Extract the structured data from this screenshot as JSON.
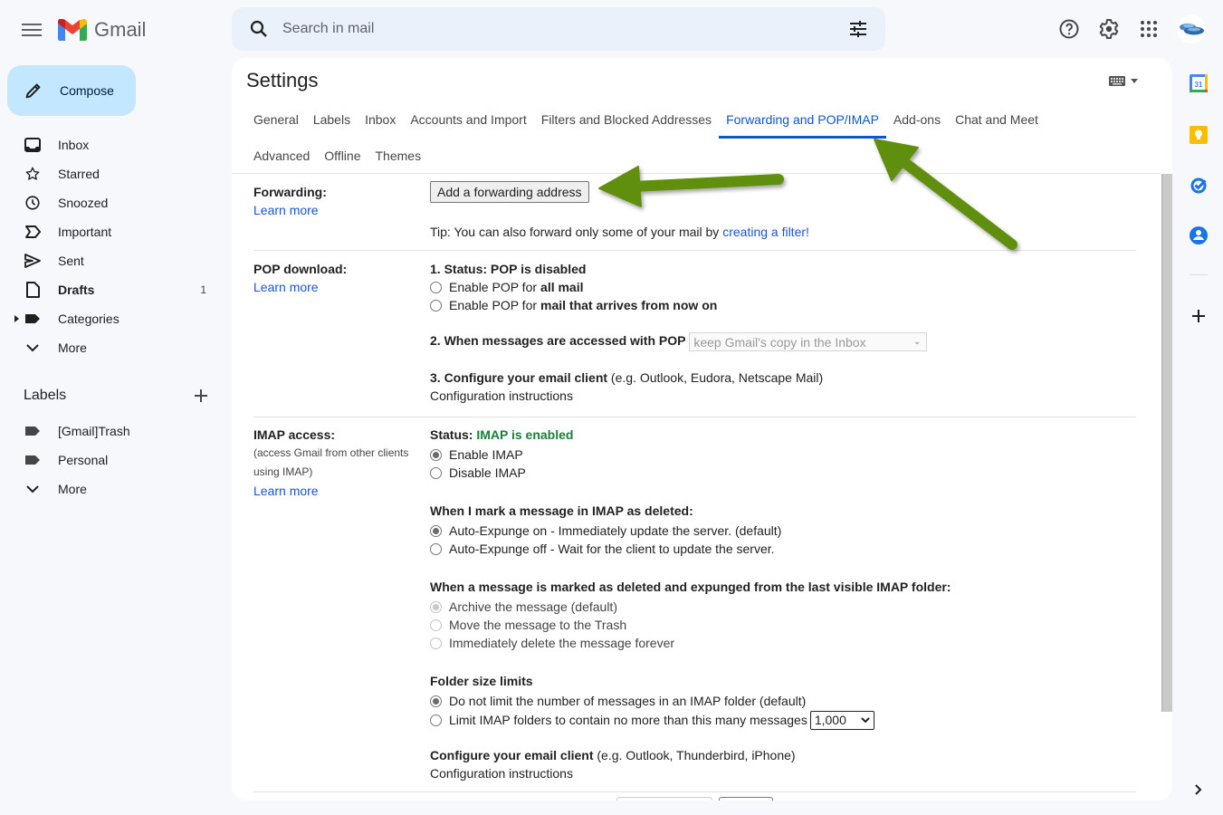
{
  "app": {
    "name": "Gmail"
  },
  "search": {
    "placeholder": "Search in mail",
    "value": ""
  },
  "compose": {
    "label": "Compose"
  },
  "nav": {
    "items": [
      {
        "label": "Inbox",
        "icon": "inbox-icon",
        "count": ""
      },
      {
        "label": "Starred",
        "icon": "star-icon",
        "count": ""
      },
      {
        "label": "Snoozed",
        "icon": "clock-icon",
        "count": ""
      },
      {
        "label": "Important",
        "icon": "important-icon",
        "count": ""
      },
      {
        "label": "Sent",
        "icon": "send-icon",
        "count": ""
      },
      {
        "label": "Drafts",
        "icon": "draft-icon",
        "count": "1",
        "bold": true
      },
      {
        "label": "Categories",
        "icon": "label-icon",
        "count": ""
      },
      {
        "label": "More",
        "icon": "chevron-down-icon",
        "count": ""
      }
    ]
  },
  "labels": {
    "heading": "Labels",
    "items": [
      {
        "label": "[Gmail]Trash"
      },
      {
        "label": "Personal"
      },
      {
        "label": "More"
      }
    ]
  },
  "settings": {
    "title": "Settings",
    "tabs_row1": [
      "General",
      "Labels",
      "Inbox",
      "Accounts and Import",
      "Filters and Blocked Addresses",
      "Forwarding and POP/IMAP",
      "Add-ons",
      "Chat and Meet"
    ],
    "tabs_row2": [
      "Advanced",
      "Offline",
      "Themes"
    ],
    "active_tab": "Forwarding and POP/IMAP",
    "forwarding": {
      "label": "Forwarding:",
      "learn_more": "Learn more",
      "button": "Add a forwarding address",
      "tip_prefix": "Tip: You can also forward only some of your mail by ",
      "tip_link": "creating a filter!"
    },
    "pop": {
      "label": "POP download:",
      "learn_more": "Learn more",
      "status": "1. Status: POP is disabled",
      "opt1_prefix": "Enable POP for ",
      "opt1_bold": "all mail",
      "opt2_prefix": "Enable POP for ",
      "opt2_bold": "mail that arrives from now on",
      "access_label": "2. When messages are accessed with POP",
      "access_select": "keep Gmail's copy in the Inbox",
      "configure_bold": "3. Configure your email client",
      "configure_rest": " (e.g. Outlook, Eudora, Netscape Mail)",
      "config_link": "Configuration instructions"
    },
    "imap": {
      "label": "IMAP access:",
      "sub1": "(access Gmail from other clients",
      "sub2": "using IMAP)",
      "learn_more": "Learn more",
      "status_prefix": "Status: ",
      "status_value": "IMAP is enabled",
      "enable": "Enable IMAP",
      "disable": "Disable IMAP",
      "deleted_heading": "When I mark a message in IMAP as deleted:",
      "expunge_on": "Auto-Expunge on - Immediately update the server. (default)",
      "expunge_off": "Auto-Expunge off - Wait for the client to update the server.",
      "expunged_heading": "When a message is marked as deleted and expunged from the last visible IMAP folder:",
      "archive": "Archive the message (default)",
      "trash": "Move the message to the Trash",
      "delete_forever": "Immediately delete the message forever",
      "folder_heading": "Folder size limits",
      "no_limit": "Do not limit the number of messages in an IMAP folder (default)",
      "limit": "Limit IMAP folders to contain no more than this many messages",
      "limit_value": "1,000",
      "configure_bold": "Configure your email client",
      "configure_rest": " (e.g. Outlook, Thunderbird, iPhone)",
      "config_link": "Configuration instructions"
    }
  },
  "colors": {
    "accent": "#0b57d0",
    "link": "#1a55d6",
    "status_green": "#188038",
    "annotation_arrow": "#5f8f0a",
    "compose_bg": "#c2e7ff"
  }
}
